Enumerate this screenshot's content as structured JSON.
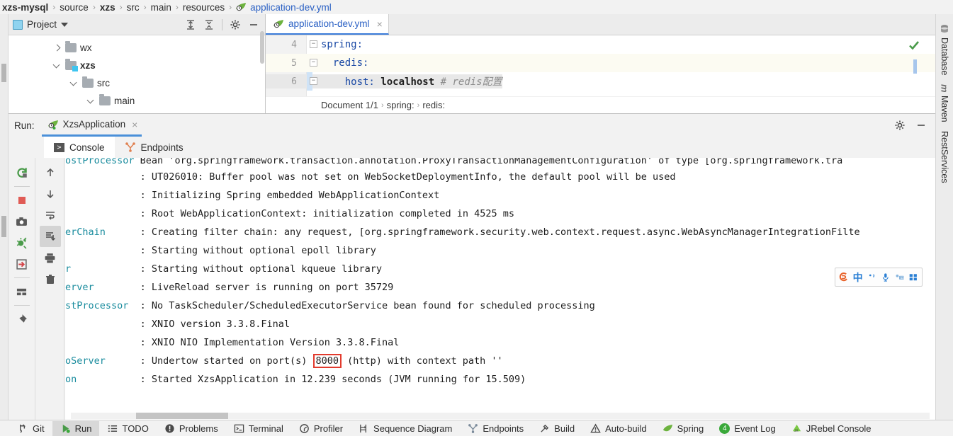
{
  "breadcrumb": {
    "items": [
      {
        "label": "xzs-mysql",
        "style": "bold"
      },
      {
        "label": "source",
        "style": "normal"
      },
      {
        "label": "xzs",
        "style": "bold"
      },
      {
        "label": "src",
        "style": "normal"
      },
      {
        "label": "main",
        "style": "normal"
      },
      {
        "label": "resources",
        "style": "normal"
      },
      {
        "label": "application-dev.yml",
        "style": "file"
      }
    ],
    "separator": "›"
  },
  "project_panel": {
    "title": "Project",
    "icons": [
      "expand-all-icon",
      "collapse-all-icon",
      "gear-icon",
      "minimize-icon"
    ],
    "tree": [
      {
        "label": "wx",
        "indent": 2,
        "twisty": "right",
        "bold": false,
        "module": false
      },
      {
        "label": "xzs",
        "indent": 2,
        "twisty": "down",
        "bold": true,
        "module": true
      },
      {
        "label": "src",
        "indent": 3,
        "twisty": "down",
        "bold": false,
        "module": false
      },
      {
        "label": "main",
        "indent": 4,
        "twisty": "down",
        "bold": false,
        "module": false
      }
    ]
  },
  "editor": {
    "tab": {
      "label": "application-dev.yml",
      "close": "×"
    },
    "lines": [
      {
        "num": "4",
        "indent": 0,
        "fold": "−",
        "tokens": [
          {
            "t": "spring:",
            "c": "k-key"
          }
        ]
      },
      {
        "num": "5",
        "indent": 1,
        "fold": "−",
        "tokens": [
          {
            "t": "  redis:",
            "c": "k-key"
          }
        ],
        "highlight": true
      },
      {
        "num": "6",
        "indent": 2,
        "fold": "−",
        "tokens": [
          {
            "t": "    host: ",
            "c": "k-prop"
          },
          {
            "t": "localhost",
            "c": "k-val"
          },
          {
            "t": " ",
            "c": "k-val"
          },
          {
            "t": "# redis配置",
            "c": "k-cmt"
          }
        ],
        "caret": true
      }
    ],
    "crumbs": [
      "Document 1/1",
      "spring:",
      "redis:"
    ],
    "crumb_sep": "›",
    "status": "no-errors"
  },
  "run_window": {
    "label": "Run:",
    "tab": {
      "label": "XzsApplication",
      "close": "×"
    },
    "header_icons": [
      "gear-icon",
      "minimize-icon"
    ],
    "subtabs": [
      {
        "label": "Console",
        "icon": "console-icon",
        "active": true
      },
      {
        "label": "Endpoints",
        "icon": "endpoints-icon",
        "active": false
      }
    ],
    "toolbar_left": [
      "rerun-icon",
      "stop-icon",
      "thread-dump-icon",
      "debug-icon",
      "exit-icon",
      "layout-icon",
      "pin-icon"
    ],
    "toolbar_right": [
      "scroll-up-icon",
      "scroll-down-icon",
      "soft-wrap-icon",
      "scroll-to-end-icon",
      "print-icon",
      "trash-icon"
    ],
    "console_lines": [
      {
        "logger": "ostProcessor",
        "msg": "Bean 'org.springframework.transaction.annotation.ProxyTransactionManagementConfiguration' of type [org.springframework.tra",
        "clipped": true
      },
      {
        "logger": "",
        "msg": ": UT026010: Buffer pool was not set on WebSocketDeploymentInfo, the default pool will be used"
      },
      {
        "logger": "",
        "msg": ": Initializing Spring embedded WebApplicationContext"
      },
      {
        "logger": "",
        "msg": ": Root WebApplicationContext: initialization completed in 4525 ms"
      },
      {
        "logger": "erChain",
        "msg": ": Creating filter chain: any request, [org.springframework.security.web.context.request.async.WebAsyncManagerIntegrationFilte"
      },
      {
        "logger": "",
        "msg": ": Starting without optional epoll library"
      },
      {
        "logger": "r",
        "msg": ": Starting without optional kqueue library"
      },
      {
        "logger": "erver",
        "msg": ": LiveReload server is running on port 35729"
      },
      {
        "logger": "stProcessor",
        "msg": ": No TaskScheduler/ScheduledExecutorService bean found for scheduled processing"
      },
      {
        "logger": "",
        "msg": ": XNIO version 3.3.8.Final"
      },
      {
        "logger": "",
        "msg": ": XNIO NIO Implementation Version 3.3.8.Final"
      },
      {
        "logger": "oServer",
        "msg_before": ": Undertow started on port(s) ",
        "boxed": "8000",
        "msg_after": " (http) with context path ''",
        "has_box": true
      },
      {
        "logger": "on",
        "msg": ": Started XzsApplication in 12.239 seconds (JVM running for 15.509)"
      }
    ]
  },
  "right_tabs": [
    {
      "label": "Database",
      "icon": "database-icon"
    },
    {
      "label": "Maven",
      "icon": "maven-icon"
    },
    {
      "label": "RestServices",
      "icon": "rest-icon"
    }
  ],
  "statusbar": {
    "items": [
      {
        "label": "Git",
        "icon": "git-icon",
        "active": false
      },
      {
        "label": "Run",
        "icon": "run-icon",
        "active": true
      },
      {
        "label": "TODO",
        "icon": "todo-icon",
        "active": false
      },
      {
        "label": "Problems",
        "icon": "problems-icon",
        "active": false
      },
      {
        "label": "Terminal",
        "icon": "terminal-icon",
        "active": false
      },
      {
        "label": "Profiler",
        "icon": "profiler-icon",
        "active": false
      },
      {
        "label": "Sequence Diagram",
        "icon": "sequence-diagram-icon",
        "active": false
      },
      {
        "label": "Endpoints",
        "icon": "endpoints-icon",
        "active": false
      },
      {
        "label": "Build",
        "icon": "build-icon",
        "active": false
      },
      {
        "label": "Auto-build",
        "icon": "auto-build-icon",
        "active": false
      },
      {
        "label": "Spring",
        "icon": "spring-icon",
        "active": false
      },
      {
        "label": "Event Log",
        "icon": "event-log-badge",
        "badge": "4",
        "active": false
      },
      {
        "label": "JRebel Console",
        "icon": "jrebel-icon",
        "active": false
      }
    ]
  },
  "ime": {
    "items": [
      "sogou-logo-icon",
      "chinese-mode-icon",
      "punctuation-icon",
      "microphone-icon",
      "keyboard-icon",
      "menu-grid-icon"
    ],
    "mode_label": "中"
  },
  "colors": {
    "accent": "#3c7ddb",
    "annotation_red": "#e23b2e",
    "logger_teal": "#1a8c9e",
    "ok_green": "#3aa93a"
  }
}
